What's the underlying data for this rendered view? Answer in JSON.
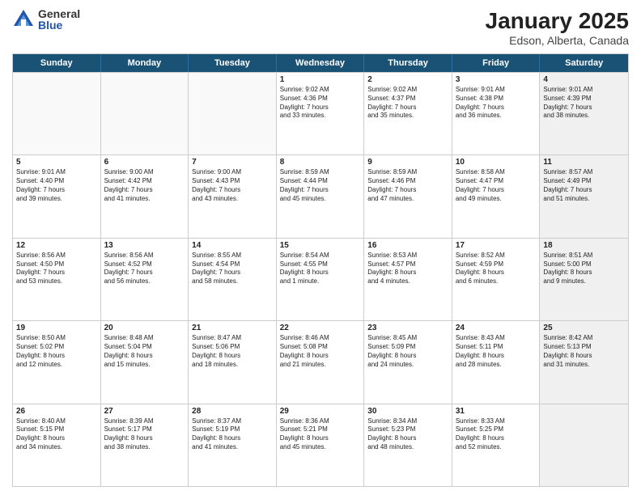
{
  "logo": {
    "general": "General",
    "blue": "Blue"
  },
  "title": "January 2025",
  "subtitle": "Edson, Alberta, Canada",
  "header_days": [
    "Sunday",
    "Monday",
    "Tuesday",
    "Wednesday",
    "Thursday",
    "Friday",
    "Saturday"
  ],
  "rows": [
    [
      {
        "day": "",
        "text": "",
        "empty": true
      },
      {
        "day": "",
        "text": "",
        "empty": true
      },
      {
        "day": "",
        "text": "",
        "empty": true
      },
      {
        "day": "1",
        "text": "Sunrise: 9:02 AM\nSunset: 4:36 PM\nDaylight: 7 hours\nand 33 minutes.",
        "empty": false
      },
      {
        "day": "2",
        "text": "Sunrise: 9:02 AM\nSunset: 4:37 PM\nDaylight: 7 hours\nand 35 minutes.",
        "empty": false
      },
      {
        "day": "3",
        "text": "Sunrise: 9:01 AM\nSunset: 4:38 PM\nDaylight: 7 hours\nand 36 minutes.",
        "empty": false
      },
      {
        "day": "4",
        "text": "Sunrise: 9:01 AM\nSunset: 4:39 PM\nDaylight: 7 hours\nand 38 minutes.",
        "empty": false,
        "shaded": true
      }
    ],
    [
      {
        "day": "5",
        "text": "Sunrise: 9:01 AM\nSunset: 4:40 PM\nDaylight: 7 hours\nand 39 minutes.",
        "empty": false
      },
      {
        "day": "6",
        "text": "Sunrise: 9:00 AM\nSunset: 4:42 PM\nDaylight: 7 hours\nand 41 minutes.",
        "empty": false
      },
      {
        "day": "7",
        "text": "Sunrise: 9:00 AM\nSunset: 4:43 PM\nDaylight: 7 hours\nand 43 minutes.",
        "empty": false
      },
      {
        "day": "8",
        "text": "Sunrise: 8:59 AM\nSunset: 4:44 PM\nDaylight: 7 hours\nand 45 minutes.",
        "empty": false
      },
      {
        "day": "9",
        "text": "Sunrise: 8:59 AM\nSunset: 4:46 PM\nDaylight: 7 hours\nand 47 minutes.",
        "empty": false
      },
      {
        "day": "10",
        "text": "Sunrise: 8:58 AM\nSunset: 4:47 PM\nDaylight: 7 hours\nand 49 minutes.",
        "empty": false
      },
      {
        "day": "11",
        "text": "Sunrise: 8:57 AM\nSunset: 4:49 PM\nDaylight: 7 hours\nand 51 minutes.",
        "empty": false,
        "shaded": true
      }
    ],
    [
      {
        "day": "12",
        "text": "Sunrise: 8:56 AM\nSunset: 4:50 PM\nDaylight: 7 hours\nand 53 minutes.",
        "empty": false
      },
      {
        "day": "13",
        "text": "Sunrise: 8:56 AM\nSunset: 4:52 PM\nDaylight: 7 hours\nand 56 minutes.",
        "empty": false
      },
      {
        "day": "14",
        "text": "Sunrise: 8:55 AM\nSunset: 4:54 PM\nDaylight: 7 hours\nand 58 minutes.",
        "empty": false
      },
      {
        "day": "15",
        "text": "Sunrise: 8:54 AM\nSunset: 4:55 PM\nDaylight: 8 hours\nand 1 minute.",
        "empty": false
      },
      {
        "day": "16",
        "text": "Sunrise: 8:53 AM\nSunset: 4:57 PM\nDaylight: 8 hours\nand 4 minutes.",
        "empty": false
      },
      {
        "day": "17",
        "text": "Sunrise: 8:52 AM\nSunset: 4:59 PM\nDaylight: 8 hours\nand 6 minutes.",
        "empty": false
      },
      {
        "day": "18",
        "text": "Sunrise: 8:51 AM\nSunset: 5:00 PM\nDaylight: 8 hours\nand 9 minutes.",
        "empty": false,
        "shaded": true
      }
    ],
    [
      {
        "day": "19",
        "text": "Sunrise: 8:50 AM\nSunset: 5:02 PM\nDaylight: 8 hours\nand 12 minutes.",
        "empty": false
      },
      {
        "day": "20",
        "text": "Sunrise: 8:48 AM\nSunset: 5:04 PM\nDaylight: 8 hours\nand 15 minutes.",
        "empty": false
      },
      {
        "day": "21",
        "text": "Sunrise: 8:47 AM\nSunset: 5:06 PM\nDaylight: 8 hours\nand 18 minutes.",
        "empty": false
      },
      {
        "day": "22",
        "text": "Sunrise: 8:46 AM\nSunset: 5:08 PM\nDaylight: 8 hours\nand 21 minutes.",
        "empty": false
      },
      {
        "day": "23",
        "text": "Sunrise: 8:45 AM\nSunset: 5:09 PM\nDaylight: 8 hours\nand 24 minutes.",
        "empty": false
      },
      {
        "day": "24",
        "text": "Sunrise: 8:43 AM\nSunset: 5:11 PM\nDaylight: 8 hours\nand 28 minutes.",
        "empty": false
      },
      {
        "day": "25",
        "text": "Sunrise: 8:42 AM\nSunset: 5:13 PM\nDaylight: 8 hours\nand 31 minutes.",
        "empty": false,
        "shaded": true
      }
    ],
    [
      {
        "day": "26",
        "text": "Sunrise: 8:40 AM\nSunset: 5:15 PM\nDaylight: 8 hours\nand 34 minutes.",
        "empty": false
      },
      {
        "day": "27",
        "text": "Sunrise: 8:39 AM\nSunset: 5:17 PM\nDaylight: 8 hours\nand 38 minutes.",
        "empty": false
      },
      {
        "day": "28",
        "text": "Sunrise: 8:37 AM\nSunset: 5:19 PM\nDaylight: 8 hours\nand 41 minutes.",
        "empty": false
      },
      {
        "day": "29",
        "text": "Sunrise: 8:36 AM\nSunset: 5:21 PM\nDaylight: 8 hours\nand 45 minutes.",
        "empty": false
      },
      {
        "day": "30",
        "text": "Sunrise: 8:34 AM\nSunset: 5:23 PM\nDaylight: 8 hours\nand 48 minutes.",
        "empty": false
      },
      {
        "day": "31",
        "text": "Sunrise: 8:33 AM\nSunset: 5:25 PM\nDaylight: 8 hours\nand 52 minutes.",
        "empty": false
      },
      {
        "day": "",
        "text": "",
        "empty": true,
        "shaded": true
      }
    ]
  ]
}
